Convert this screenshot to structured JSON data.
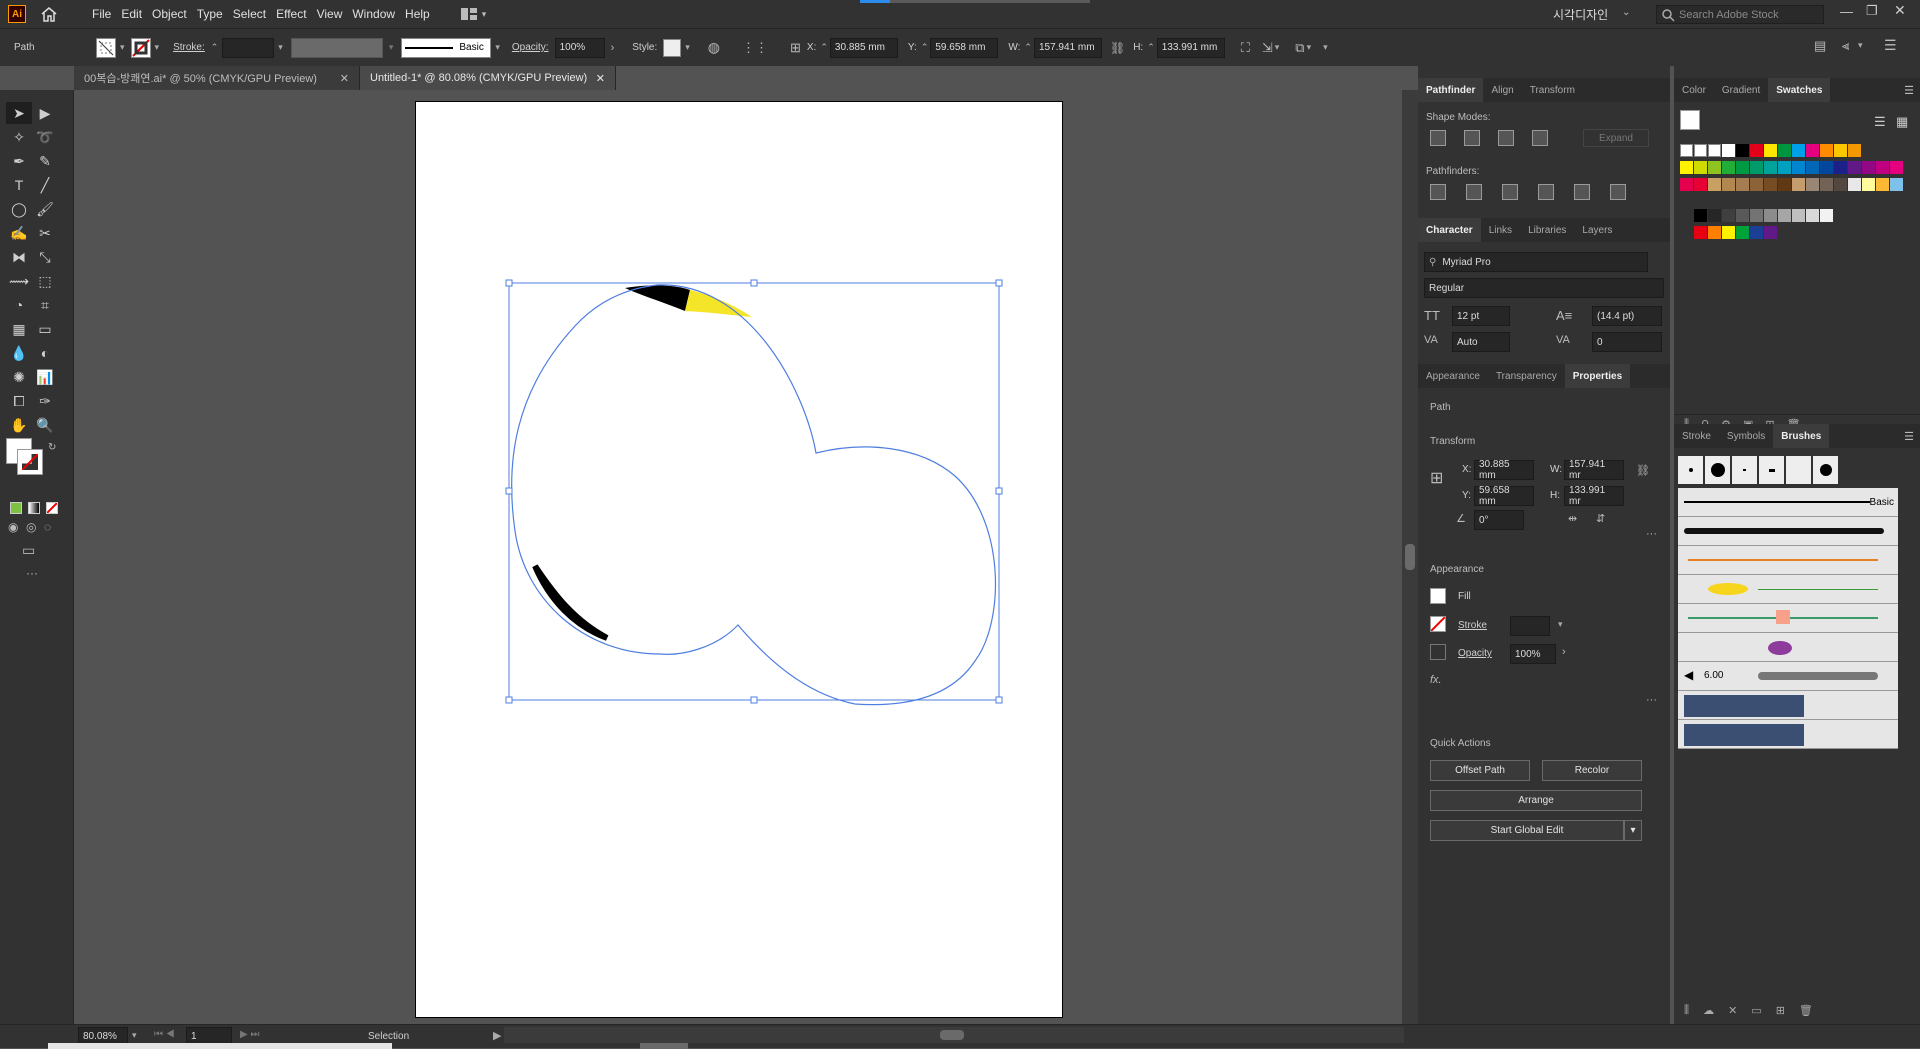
{
  "app": {
    "logo": "Ai",
    "home_icon": "home-icon"
  },
  "menu": [
    "File",
    "Edit",
    "Object",
    "Type",
    "Select",
    "Effect",
    "View",
    "Window",
    "Help"
  ],
  "workspace": "시각디자인",
  "search": {
    "placeholder": "Search Adobe Stock"
  },
  "control": {
    "selection_type": "Path",
    "stroke_label": "Stroke:",
    "stroke_profile": "Basic",
    "opacity_label": "Opacity:",
    "opacity_value": "100%",
    "style_label": "Style:",
    "x_label": "X:",
    "x_value": "30.885 mm",
    "y_label": "Y:",
    "y_value": "59.658 mm",
    "w_label": "W:",
    "w_value": "157.941 mm",
    "h_label": "H:",
    "h_value": "133.991 mm"
  },
  "tabs": [
    {
      "label": "00복습-방쾌연.ai* @ 50% (CMYK/GPU Preview)"
    },
    {
      "label": "Untitled-1* @ 80.08% (CMYK/GPU Preview)"
    }
  ],
  "pathfinder": {
    "tabs": [
      "Pathfinder",
      "Align",
      "Transform"
    ],
    "shape_modes": "Shape Modes:",
    "expand": "Expand",
    "pathfinders": "Pathfinders:"
  },
  "character": {
    "tabs": [
      "Character",
      "Links",
      "Libraries",
      "Layers"
    ],
    "font": "Myriad Pro",
    "style": "Regular",
    "size": "12 pt",
    "leading": "(14.4 pt)",
    "kerning": "Auto",
    "tracking": "0"
  },
  "properties": {
    "tabs": [
      "Appearance",
      "Transparency",
      "Properties"
    ],
    "path_label": "Path",
    "transform_label": "Transform",
    "x_label": "X:",
    "x": "30.885 mm",
    "y_label": "Y:",
    "y": "59.658 mm",
    "w_label": "W:",
    "w": "157.941 mr",
    "h_label": "H:",
    "h": "133.991 mr",
    "angle": "0°",
    "appearance_label": "Appearance",
    "fill_label": "Fill",
    "stroke_label": "Stroke",
    "opacity_label": "Opacity",
    "opacity": "100%",
    "fx": "fx.",
    "quick_actions": "Quick Actions",
    "offset_path": "Offset Path",
    "recolor": "Recolor",
    "arrange": "Arrange",
    "global_edit": "Start Global Edit"
  },
  "swatches": {
    "tabs": [
      "Color",
      "Gradient",
      "Swatches"
    ],
    "row1": [
      "#ffffff",
      "#000000",
      "#e3001b",
      "#ffe600",
      "#00963f",
      "#00a0e9",
      "#e4007f",
      "#ff8c00",
      "#fcc800",
      "#f39800"
    ],
    "row2": [
      "#fff100",
      "#cfdb00",
      "#8fc31f",
      "#22ac38",
      "#009944",
      "#009b6b",
      "#00a29a",
      "#00a0c1",
      "#0086d1",
      "#0068b7",
      "#00479d",
      "#1d2088",
      "#601986",
      "#920783",
      "#be0081",
      "#e4007f"
    ],
    "row3": [
      "#e5004f",
      "#e60033",
      "#c8a063",
      "#b28850",
      "#a67c52",
      "#8c6239",
      "#754c24",
      "#603813",
      "#c69c6d",
      "#998675",
      "#736357",
      "#534741",
      "#e8e8e8",
      "#fffa9c",
      "#fdb933",
      "#7ec2eb"
    ],
    "row5": [
      "#000000",
      "#262626",
      "#3f3f3f",
      "#595959",
      "#737373",
      "#8c8c8c",
      "#a6a6a6",
      "#bfbfbf",
      "#d9d9d9",
      "#f2f2f2"
    ],
    "row6": [
      "#e60012",
      "#ff7f00",
      "#fff100",
      "#00a23a",
      "#1b3f94",
      "#601986"
    ]
  },
  "brushes": {
    "tabs": [
      "Stroke",
      "Symbols",
      "Brushes"
    ],
    "basic": "Basic",
    "size": "6.00"
  },
  "status": {
    "zoom": "80.08%",
    "page": "1",
    "tool": "Selection"
  }
}
